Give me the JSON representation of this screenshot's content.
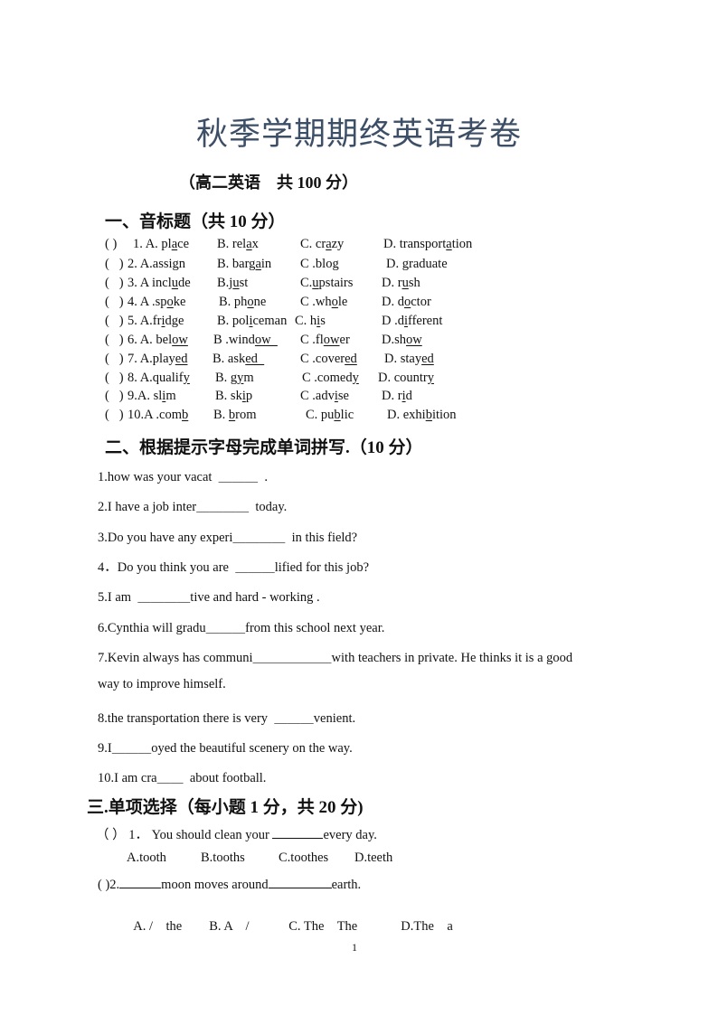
{
  "document": {
    "title": "秋季学期期终英语考卷",
    "subtitle": "（高二英语　共 100 分）",
    "page_number": "1"
  },
  "section1": {
    "heading": "一、音标题（共 10 分）",
    "rows": [
      {
        "paren": "( )",
        "opts": [
          {
            "pre": "1. A. pl",
            "u": "a",
            "post": "ce"
          },
          {
            "pre": "B. rel",
            "u": "a",
            "post": "x"
          },
          {
            "pre": "C. cr",
            "u": "a",
            "post": "zy"
          },
          {
            "pre": "D. transport",
            "u": "a",
            "post": "tion"
          }
        ]
      },
      {
        "paren": "(   )",
        "opts": [
          {
            "pre": "2. A.assi",
            "u": "g",
            "post": "n"
          },
          {
            "pre": "B. barg",
            "u": "a",
            "post": "in"
          },
          {
            "pre": "C .blo",
            "u": "g",
            "post": ""
          },
          {
            "pre": "D. ",
            "u": "g",
            "post": "raduate"
          }
        ]
      },
      {
        "paren": "(   )",
        "opts": [
          {
            "pre": "3. A incl",
            "u": "u",
            "post": "de"
          },
          {
            "pre": "B.j",
            "u": "u",
            "post": "st"
          },
          {
            "pre": "C.",
            "u": "u",
            "post": "pstairs"
          },
          {
            "pre": "D. r",
            "u": "u",
            "post": "sh"
          }
        ]
      },
      {
        "paren": "(   )",
        "opts": [
          {
            "pre": "4. A .sp",
            "u": "o",
            "post": "ke"
          },
          {
            "pre": "B. ph",
            "u": "o",
            "post": "ne"
          },
          {
            "pre": "C .wh",
            "u": "o",
            "post": "le"
          },
          {
            "pre": "D. d",
            "u": "o",
            "post": "ctor"
          }
        ]
      },
      {
        "paren": "(   )",
        "opts": [
          {
            "pre": "5. A.fr",
            "u": "i",
            "post": "dge"
          },
          {
            "pre": "B. pol",
            "u": "i",
            "post": "ceman"
          },
          {
            "pre": "C. h",
            "u": "i",
            "post": "s"
          },
          {
            "pre": "D .d",
            "u": "i",
            "post": "fferent"
          }
        ]
      },
      {
        "paren": "(   )",
        "opts": [
          {
            "pre": "6. A. bel",
            "u": "ow",
            "post": ""
          },
          {
            "pre": "B .wind",
            "u": "ow  ",
            "post": ""
          },
          {
            "pre": "C .fl",
            "u": "ow",
            "post": "er"
          },
          {
            "pre": "D.sh",
            "u": "ow",
            "post": ""
          }
        ]
      },
      {
        "paren": "(   )",
        "opts": [
          {
            "pre": "7. A.play",
            "u": "ed",
            "post": ""
          },
          {
            "pre": "B. ask",
            "u": "ed  ",
            "post": ""
          },
          {
            "pre": "C .cover",
            "u": "ed",
            "post": ""
          },
          {
            "pre": "D. stay",
            "u": "ed",
            "post": ""
          }
        ]
      },
      {
        "paren": "(   )",
        "opts": [
          {
            "pre": "8. A.qualif",
            "u": "y",
            "post": ""
          },
          {
            "pre": "B. g",
            "u": "y",
            "post": "m"
          },
          {
            "pre": "C .comed",
            "u": "y",
            "post": ""
          },
          {
            "pre": "D. countr",
            "u": "y",
            "post": ""
          }
        ]
      },
      {
        "paren": "(   )",
        "opts": [
          {
            "pre": "9.A. sl",
            "u": "i",
            "post": "m"
          },
          {
            "pre": "B. sk",
            "u": "i",
            "post": "p"
          },
          {
            "pre": "C .adv",
            "u": "i",
            "post": "se"
          },
          {
            "pre": "D. r",
            "u": "i",
            "post": "d"
          }
        ]
      },
      {
        "paren": "(   )",
        "opts": [
          {
            "pre": "10.A .com",
            "u": "b",
            "post": ""
          },
          {
            "pre": "B. ",
            "u": "b",
            "post": "rom"
          },
          {
            "pre": "C. pu",
            "u": "b",
            "post": "lic"
          },
          {
            "pre": "D. exhi",
            "u": "b",
            "post": "ition"
          }
        ]
      }
    ]
  },
  "section2": {
    "heading": "二、根据提示字母完成单词拼写.（10 分）",
    "items": [
      "1.how was your vacat  ＿＿＿  .",
      "2.I have a job inter＿＿＿＿  today.",
      "3.Do you have any experi＿＿＿＿  in this field?",
      "4．Do you think you are  ＿＿＿lified for this job?",
      "5.I am  ＿＿＿＿tive and hard - working .",
      "6.Cynthia will gradu＿＿＿from this school next year.",
      "7.Kevin always has communi＿＿＿＿＿＿with teachers in private. He thinks it is a good",
      "way to improve himself.",
      "8.the transportation there is very  ＿＿＿venient.",
      "9.I＿＿＿oyed the beautiful scenery on the way.",
      "10.I am cra＿＿  about football."
    ]
  },
  "section3": {
    "heading": "三.单项选择（每小题 1 分，共 20 分)",
    "questions": [
      {
        "paren": "（ ）",
        "num": "1．",
        "stem_before": "You should clean your ",
        "stem_after": "every day.",
        "options": [
          "A.tooth",
          "B.tooths",
          "C.toothes",
          "D.teeth"
        ]
      },
      {
        "paren": "(   )",
        "num": "2.",
        "stem_before": "",
        "stem_mid": "moon moves around",
        "stem_after": "earth.",
        "options": [
          "A. /    the",
          "B. A    /",
          "C. The    The",
          "D.The    a"
        ]
      }
    ]
  }
}
